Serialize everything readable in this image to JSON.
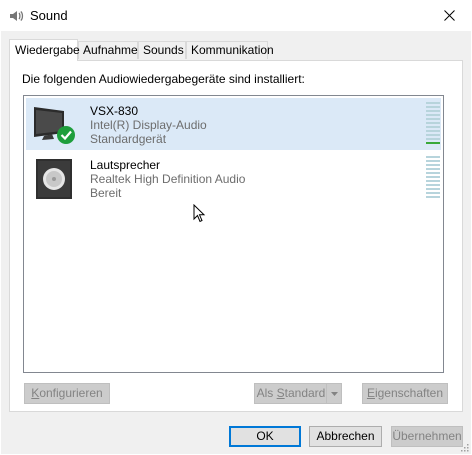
{
  "window": {
    "title": "Sound"
  },
  "tabs": [
    {
      "label": "Wiedergabe"
    },
    {
      "label": "Aufnahme"
    },
    {
      "label": "Sounds"
    },
    {
      "label": "Kommunikation"
    }
  ],
  "playback": {
    "intro": "Die folgenden Audiowiedergabegeräte sind installiert:",
    "devices": [
      {
        "name": "VSX-830",
        "subtitle": "Intel(R) Display-Audio",
        "status": "Standardgerät",
        "icon": "monitor-speaker-icon",
        "selected": true,
        "default": true,
        "level_fraction": 0.08
      },
      {
        "name": "Lautsprecher",
        "subtitle": "Realtek High Definition Audio",
        "status": "Bereit",
        "icon": "speaker-icon",
        "selected": false,
        "default": false,
        "level_fraction": 0
      }
    ],
    "configure_label": "Konfigurieren",
    "set_default_label": "Als Standard",
    "properties_label": "Eigenschaften"
  },
  "footer": {
    "ok_label": "OK",
    "cancel_label": "Abbrechen",
    "apply_label": "Übernehmen"
  },
  "colors": {
    "selection": "#dbe9f7",
    "accent": "#0078d7",
    "level_active": "#3aa93a",
    "check": "#1e9e3c"
  }
}
